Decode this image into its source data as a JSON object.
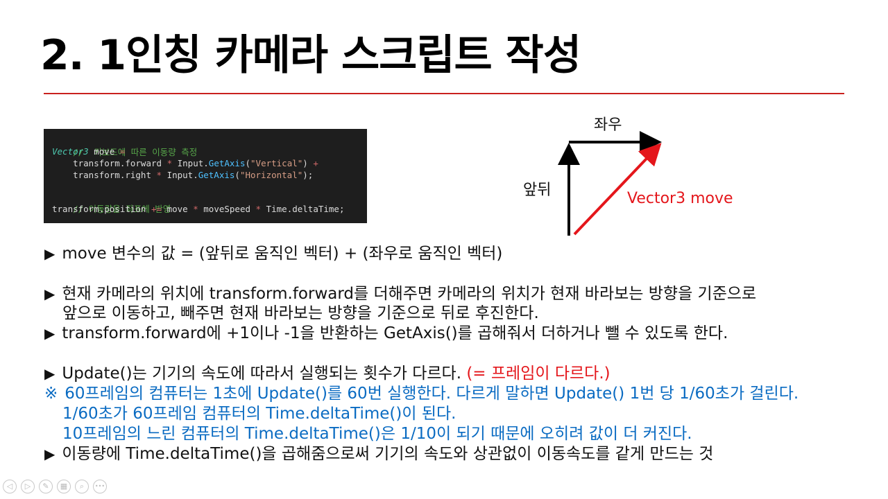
{
  "title": "2. 1인칭 카메라 스크립트 작성",
  "code": {
    "comment1": "//  키보드에 따른 이동량 측정",
    "line2_type": "Vector3",
    "line2_rest": " move ",
    "line2_eq": "=",
    "line3_a": "    transform.forward ",
    "line3_op": "*",
    "line3_b": " Input.",
    "line3_fn": "GetAxis",
    "line3_p1": "(",
    "line3_str": "\"Vertical\"",
    "line3_p2": ") ",
    "line3_plus": "+",
    "line4_a": "    transform.right ",
    "line4_op": "*",
    "line4_b": " Input.",
    "line4_fn": "GetAxis",
    "line4_p1": "(",
    "line4_str": "\"Horizontal\"",
    "line4_p2": ");",
    "comment2": "// 이동량을 좌표에 반영",
    "line6_a": "transform.position ",
    "line6_op1": "+=",
    "line6_b": " move ",
    "line6_op2": "*",
    "line6_c": " moveSpeed ",
    "line6_op3": "*",
    "line6_d": " Time.deltaTime;"
  },
  "diagram": {
    "label_lr": "좌우",
    "label_fb": "앞뒤",
    "label_vec": "Vector3 move",
    "arrow_color_black": "#000000",
    "arrow_color_red": "#e4161b"
  },
  "lines": {
    "l1": "move 변수의 값 = (앞뒤로 움직인 벡터) + (좌우로 움직인 벡터)",
    "l2": "현재 카메라의 위치에 transform.forward를 더해주면 카메라의 위치가 현재 바라보는 방향을 기준으로",
    "l3": "앞으로 이동하고, 빼주면 현재 바라보는 방향을 기준으로 뒤로 후진한다.",
    "l4": "transform.forward에 +1이나 -1을 반환하는 GetAxis()를 곱해줘서 더하거나 뺄 수 있도록 한다.",
    "l5": "Update()는 기기의 속도에 따라서 실행되는 횟수가 다르다.",
    "l5_red": "(= 프레임이 다르다.)",
    "l6": "60프레임의 컴퓨터는 1초에 Update()를 60번 실행한다. 다르게 말하면 Update() 1번 당 1/60초가 걸린다.",
    "l7": "1/60초가 60프레임 컴퓨터의 Time.deltaTime()이 된다.",
    "l8": "10프레임의 느린 컴퓨터의 Time.deltaTime()은 1/10이 되기 때문에 오히려 값이 더 커진다.",
    "l9": "이동량에 Time.deltaTime()을 곱해줌으로써 기기의 속도와 상관없이 이동속도를 같게 만드는 것"
  },
  "symbols": {
    "bullet": "▶",
    "note": "※"
  },
  "controls": {
    "prev_icon": "◁",
    "next_icon": "▷",
    "pen_icon": "✎",
    "slides_icon": "▦",
    "zoom_icon": "⌕",
    "more_icon": "•••"
  }
}
